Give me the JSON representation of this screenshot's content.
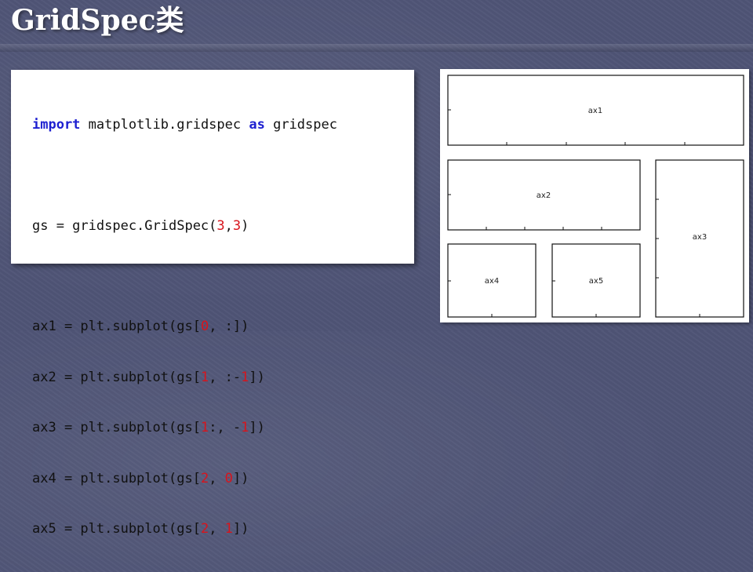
{
  "title": "GridSpec类",
  "code": {
    "line1": {
      "kw1": "import",
      "mid": " matplotlib.gridspec ",
      "kw2": "as",
      "tail": " gridspec"
    },
    "line2": {
      "pre": "gs = gridspec.GridSpec(",
      "n1": "3",
      "sep": ",",
      "n2": "3",
      "post": ")"
    },
    "line3": {
      "pre": "ax1 = plt.subplot(gs[",
      "n1": "0",
      "post": ", :])"
    },
    "line4": {
      "pre": "ax2 = plt.subplot(gs[",
      "n1": "1",
      "mid": ", :-",
      "n2": "1",
      "post": "])"
    },
    "line5": {
      "pre": "ax3 = plt.subplot(gs[",
      "n1": "1",
      "mid": ":, -",
      "n2": "1",
      "post": "])"
    },
    "line6": {
      "pre": "ax4 = plt.subplot(gs[",
      "n1": "2",
      "mid": ", ",
      "n2": "0",
      "post": "])"
    },
    "line7": {
      "pre": "ax5 = plt.subplot(gs[",
      "n1": "2",
      "mid": ", ",
      "n2": "1",
      "post": "])"
    }
  },
  "diagram": {
    "ax1": "ax1",
    "ax2": "ax2",
    "ax3": "ax3",
    "ax4": "ax4",
    "ax5": "ax5"
  }
}
